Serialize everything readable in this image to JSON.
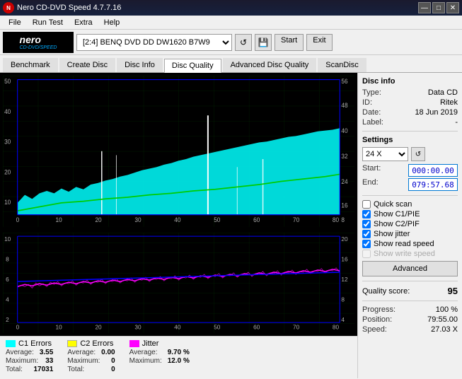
{
  "titlebar": {
    "title": "Nero CD-DVD Speed 4.7.7.16",
    "logo_text": "N",
    "btn_minimize": "—",
    "btn_maximize": "□",
    "btn_close": "✕"
  },
  "menubar": {
    "items": [
      "File",
      "Run Test",
      "Extra",
      "Help"
    ]
  },
  "toolbar": {
    "drive_label": "[2:4]  BENQ DVD DD DW1620 B7W9",
    "start_label": "Start",
    "exit_label": "Exit"
  },
  "tabs": [
    {
      "label": "Benchmark",
      "active": false
    },
    {
      "label": "Create Disc",
      "active": false
    },
    {
      "label": "Disc Info",
      "active": false
    },
    {
      "label": "Disc Quality",
      "active": true
    },
    {
      "label": "Advanced Disc Quality",
      "active": false
    },
    {
      "label": "ScanDisc",
      "active": false
    }
  ],
  "disc_info": {
    "section_title": "Disc info",
    "type_label": "Type:",
    "type_value": "Data CD",
    "id_label": "ID:",
    "id_value": "Ritek",
    "date_label": "Date:",
    "date_value": "18 Jun 2019",
    "label_label": "Label:",
    "label_value": "-"
  },
  "settings": {
    "section_title": "Settings",
    "speed_value": "24 X",
    "start_label": "Start:",
    "start_value": "000:00.00",
    "end_label": "End:",
    "end_value": "079:57.68"
  },
  "checkboxes": {
    "quick_scan": {
      "label": "Quick scan",
      "checked": false
    },
    "c1_pie": {
      "label": "Show C1/PIE",
      "checked": true
    },
    "c2_pif": {
      "label": "Show C2/PIF",
      "checked": true
    },
    "jitter": {
      "label": "Show jitter",
      "checked": true
    },
    "read_speed": {
      "label": "Show read speed",
      "checked": true
    },
    "write_speed": {
      "label": "Show write speed",
      "checked": false,
      "disabled": true
    }
  },
  "advanced_button": "Advanced",
  "quality_score": {
    "label": "Quality score:",
    "value": "95"
  },
  "progress": {
    "label": "Progress:",
    "value": "100 %",
    "position_label": "Position:",
    "position_value": "79:55.00",
    "speed_label": "Speed:",
    "speed_value": "27.03 X"
  },
  "legend": {
    "c1": {
      "title": "C1 Errors",
      "color": "#00ffff",
      "avg_label": "Average:",
      "avg_value": "3.55",
      "max_label": "Maximum:",
      "max_value": "33",
      "total_label": "Total:",
      "total_value": "17031"
    },
    "c2": {
      "title": "C2 Errors",
      "color": "#ffff00",
      "avg_label": "Average:",
      "avg_value": "0.00",
      "max_label": "Maximum:",
      "max_value": "0",
      "total_label": "Total:",
      "total_value": "0"
    },
    "jitter": {
      "title": "Jitter",
      "color": "#ff00ff",
      "avg_label": "Average:",
      "avg_value": "9.70 %",
      "max_label": "Maximum:",
      "max_value": "12.0 %",
      "total_label": "",
      "total_value": ""
    }
  },
  "chart": {
    "top_y_left_max": "50",
    "top_y_right_max": "56",
    "bottom_y_left_max": "10",
    "bottom_y_right_max": "20",
    "x_max": "80"
  }
}
